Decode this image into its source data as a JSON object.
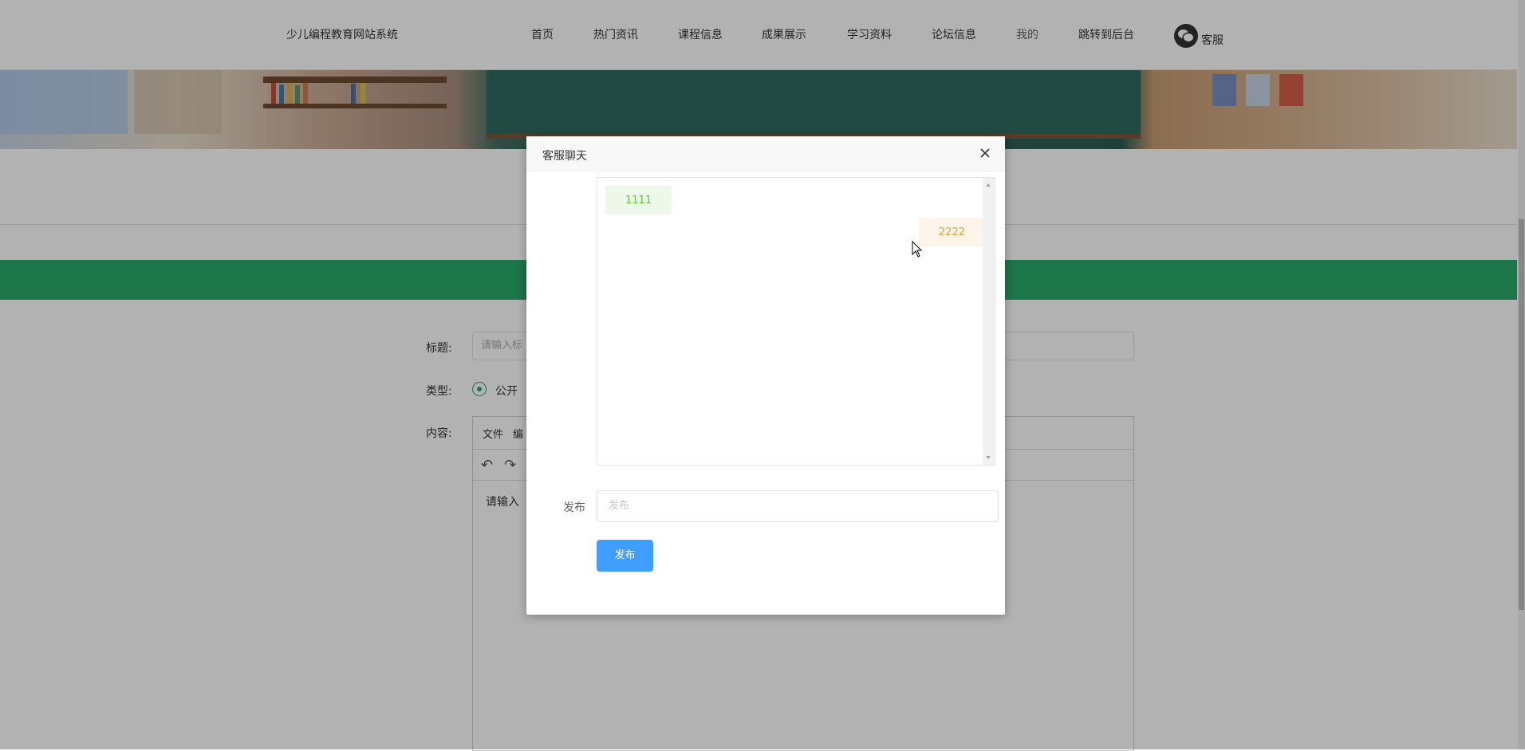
{
  "nav": {
    "site_title": "少儿编程教育网站系统",
    "items": [
      {
        "label": "首页"
      },
      {
        "label": "热门资讯"
      },
      {
        "label": "课程信息"
      },
      {
        "label": "成果展示"
      },
      {
        "label": "学习资料"
      },
      {
        "label": "论坛信息"
      },
      {
        "label": "我的"
      },
      {
        "label": "跳转到后台"
      }
    ],
    "service_label": "客服"
  },
  "form": {
    "title_label": "标题:",
    "title_placeholder": "请输入标",
    "type_label": "类型:",
    "type_option": "公开",
    "content_label": "内容:",
    "editor_menu": [
      "文件",
      "编"
    ],
    "editor_placeholder": "请输入"
  },
  "chat_modal": {
    "title": "客服聊天",
    "messages": [
      {
        "text": "1111",
        "side": "left"
      },
      {
        "text": "2222",
        "side": "right"
      }
    ],
    "publish_label": "发布",
    "publish_placeholder": "发布",
    "publish_button": "发布"
  },
  "colors": {
    "accent_green": "#2aa86b",
    "button_blue": "#409eff",
    "msg_left_text": "#67c23a",
    "msg_right_text": "#e6a23c"
  },
  "icons": [
    "wechat-icon",
    "close-icon",
    "undo-icon",
    "redo-icon"
  ]
}
